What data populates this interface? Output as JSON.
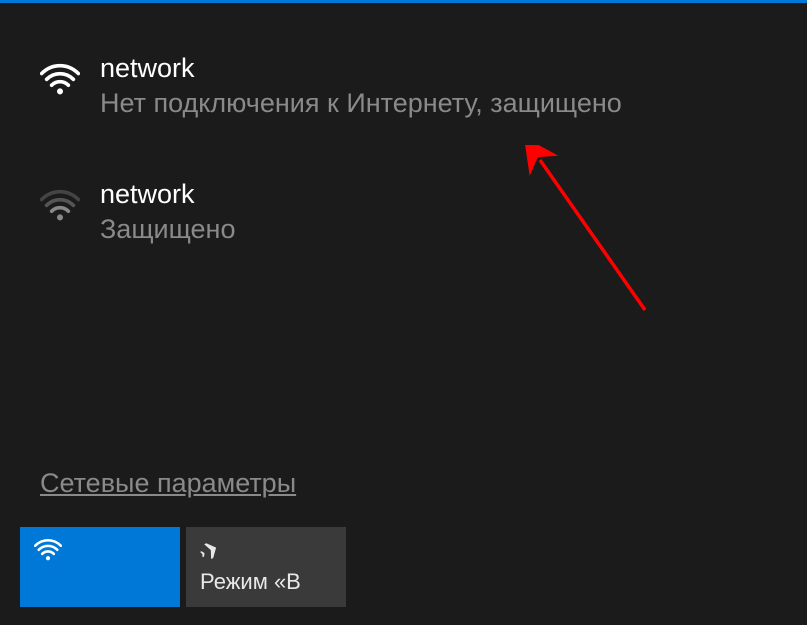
{
  "networks": [
    {
      "name": "network",
      "status": "Нет подключения к Интернету, защищено",
      "signal": "full"
    },
    {
      "name": "network",
      "status": "Защищено",
      "signal": "weak"
    }
  ],
  "settings_link": "Сетевые параметры",
  "tiles": {
    "wifi": {
      "label": ""
    },
    "airplane": {
      "label": "Режим «В"
    }
  },
  "colors": {
    "accent": "#0078d7",
    "background": "#1b1b1b",
    "tile_inactive": "#3a3a3a",
    "text_primary": "#ffffff",
    "text_secondary": "#8a8a8a",
    "annotation": "#ff0000"
  }
}
